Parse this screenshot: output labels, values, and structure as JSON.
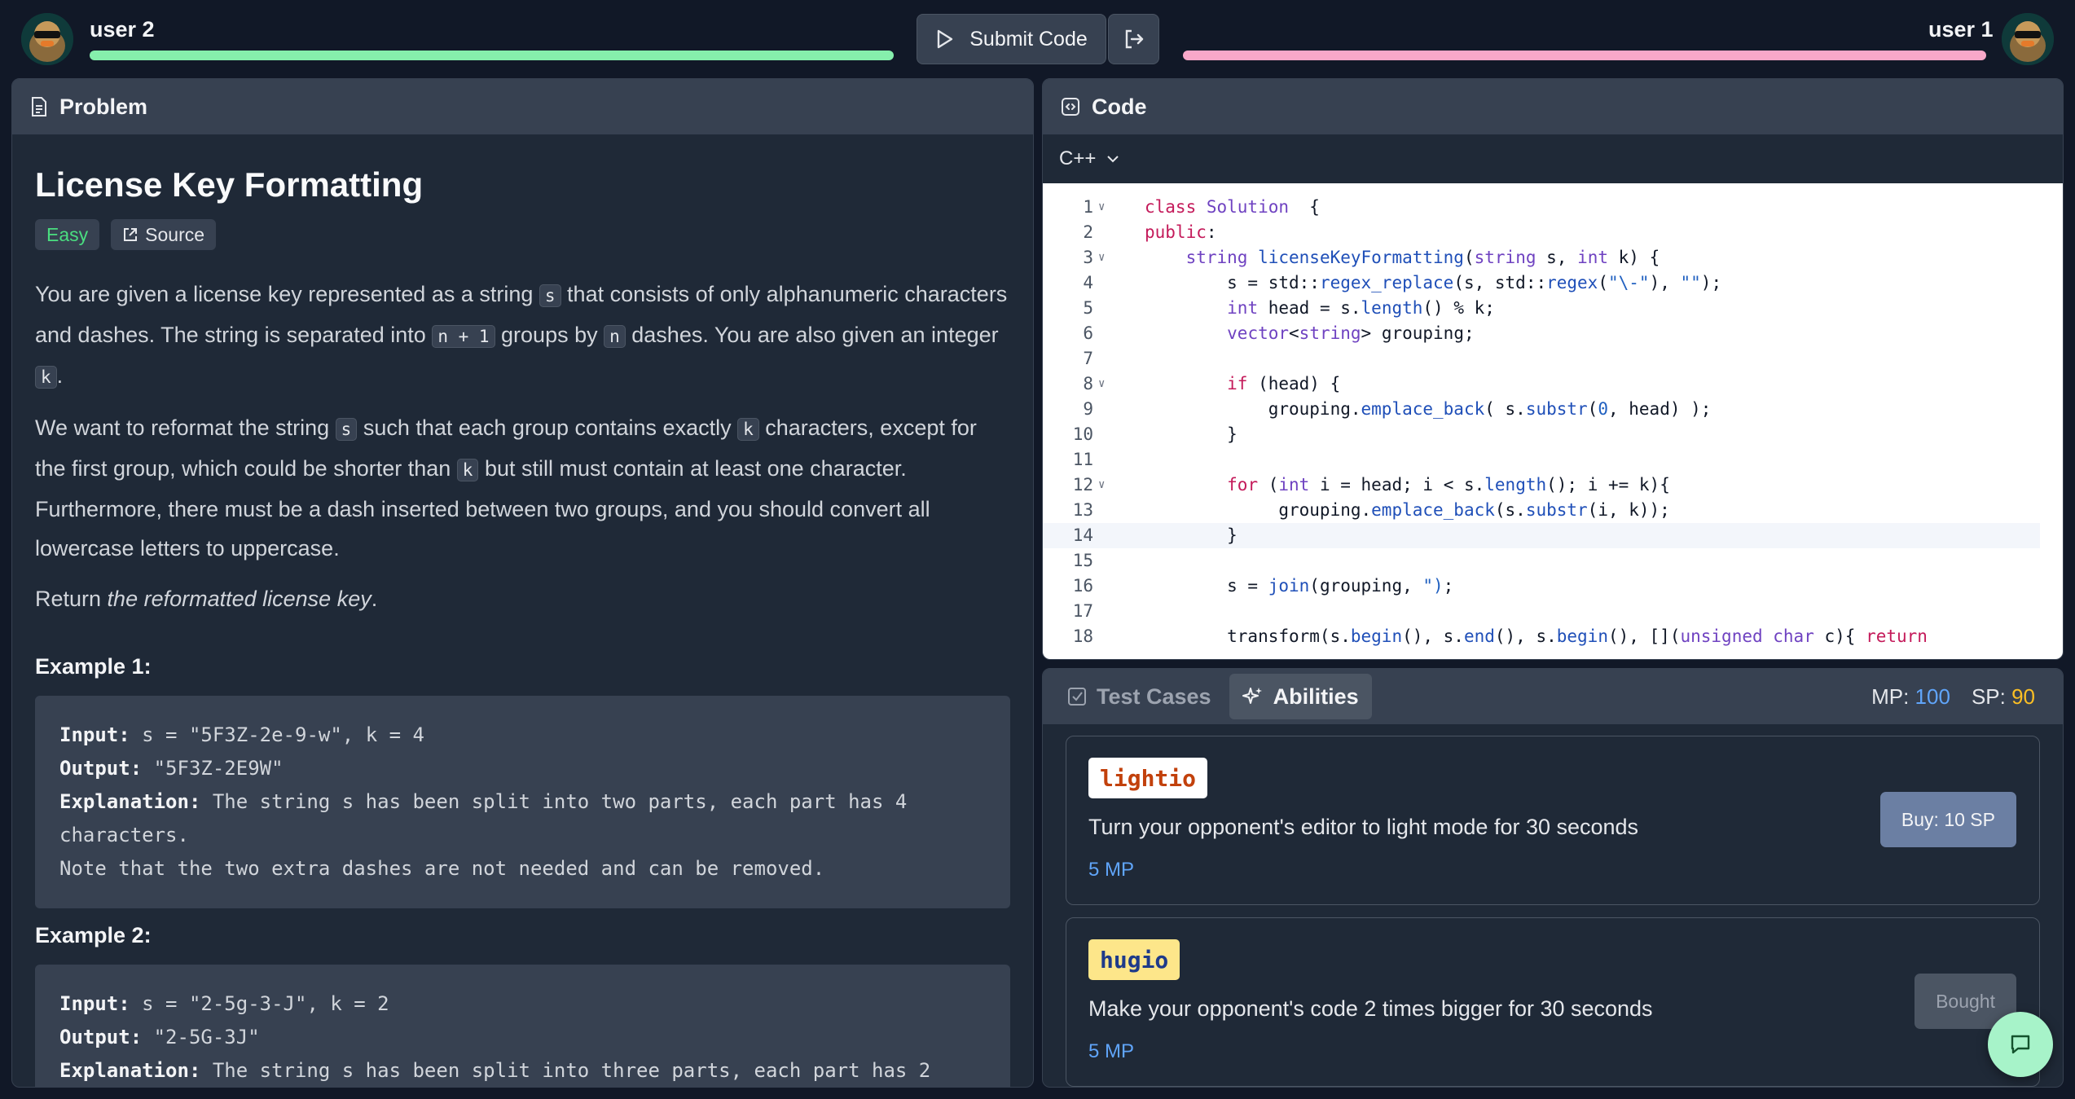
{
  "header": {
    "left_user": "user 2",
    "right_user": "user 1",
    "submit_label": "Submit Code",
    "left_bar_color": "#86efac",
    "right_bar_color": "#f9a8c9"
  },
  "problem": {
    "panel_title": "Problem",
    "title": "License Key Formatting",
    "difficulty": "Easy",
    "source_label": "Source",
    "p1": [
      "You are given a license key represented as a string ",
      "s",
      " that consists of only alphanumeric characters and dashes. The string is separated into ",
      "n + 1",
      " groups by ",
      "n",
      " dashes. You are also given an integer ",
      "k",
      "."
    ],
    "p2": [
      "We want to reformat the string ",
      "s",
      " such that each group contains exactly ",
      "k",
      " characters, except for the first group, which could be shorter than ",
      "k",
      " but still must contain at least one character. Furthermore, there must be a dash inserted between two groups, and you should convert all lowercase letters to uppercase."
    ],
    "p3_prefix": "Return ",
    "p3_em": "the reformatted license key",
    "p3_suffix": ".",
    "examples": [
      {
        "title": "Example 1:",
        "input_label": "Input:",
        "input": " s = \"5F3Z-2e-9-w\", k = 4",
        "output_label": "Output:",
        "output": " \"5F3Z-2E9W\"",
        "explanation_label": "Explanation:",
        "explanation": " The string s has been split into two parts, each part has 4",
        "explanation2": "characters.",
        "explanation3": "Note that the two extra dashes are not needed and can be removed."
      },
      {
        "title": "Example 2:",
        "input_label": "Input:",
        "input": " s = \"2-5g-3-J\", k = 2",
        "output_label": "Output:",
        "output": " \"2-5G-3J\"",
        "explanation_label": "Explanation:",
        "explanation": " The string s has been split into three parts, each part has 2"
      }
    ]
  },
  "code": {
    "panel_title": "Code",
    "language": "C++",
    "lines": [
      {
        "n": "1",
        "fold": true,
        "segs": [
          [
            "kw",
            "class "
          ],
          [
            "ty",
            "Solution"
          ],
          [
            "",
            "  {"
          ]
        ]
      },
      {
        "n": "2",
        "fold": false,
        "segs": [
          [
            "kw",
            "public"
          ],
          [
            "",
            ":"
          ]
        ]
      },
      {
        "n": "3",
        "fold": true,
        "segs": [
          [
            "",
            "    "
          ],
          [
            "ty",
            "string "
          ],
          [
            "fn",
            "licenseKeyFormatting"
          ],
          [
            "",
            "("
          ],
          [
            "ty",
            "string"
          ],
          [
            "",
            " s, "
          ],
          [
            "ty",
            "int"
          ],
          [
            "",
            " k) {"
          ]
        ]
      },
      {
        "n": "4",
        "fold": false,
        "segs": [
          [
            "",
            "        s = std::"
          ],
          [
            "fn",
            "regex_replace"
          ],
          [
            "",
            "(s, std::"
          ],
          [
            "fn",
            "regex"
          ],
          [
            "",
            "("
          ],
          [
            "st",
            "\"\\-\""
          ],
          [
            "",
            "), "
          ],
          [
            "st",
            "\"\""
          ],
          [
            "",
            ");"
          ]
        ]
      },
      {
        "n": "5",
        "fold": false,
        "segs": [
          [
            "",
            "        "
          ],
          [
            "ty",
            "int"
          ],
          [
            "",
            " head = s."
          ],
          [
            "fn",
            "length"
          ],
          [
            "",
            "() % k;"
          ]
        ]
      },
      {
        "n": "6",
        "fold": false,
        "segs": [
          [
            "",
            "        "
          ],
          [
            "ty",
            "vector"
          ],
          [
            "",
            "<"
          ],
          [
            "ty",
            "string"
          ],
          [
            "",
            "> grouping;"
          ]
        ]
      },
      {
        "n": "7",
        "fold": false,
        "segs": [
          [
            "",
            ""
          ]
        ]
      },
      {
        "n": "8",
        "fold": true,
        "segs": [
          [
            "",
            "        "
          ],
          [
            "kw",
            "if"
          ],
          [
            "",
            " (head) {"
          ]
        ]
      },
      {
        "n": "9",
        "fold": false,
        "segs": [
          [
            "",
            "            grouping."
          ],
          [
            "fn",
            "emplace_back"
          ],
          [
            "",
            "( s."
          ],
          [
            "fn",
            "substr"
          ],
          [
            "",
            "("
          ],
          [
            "st",
            "0"
          ],
          [
            "",
            ", head) );"
          ]
        ]
      },
      {
        "n": "10",
        "fold": false,
        "segs": [
          [
            "",
            "        }"
          ]
        ]
      },
      {
        "n": "11",
        "fold": false,
        "segs": [
          [
            "",
            ""
          ]
        ]
      },
      {
        "n": "12",
        "fold": true,
        "segs": [
          [
            "",
            "        "
          ],
          [
            "kw",
            "for"
          ],
          [
            "",
            " ("
          ],
          [
            "ty",
            "int"
          ],
          [
            "",
            " i = head; i < s."
          ],
          [
            "fn",
            "length"
          ],
          [
            "",
            "(); i += k){"
          ]
        ]
      },
      {
        "n": "13",
        "fold": false,
        "segs": [
          [
            "",
            "             grouping."
          ],
          [
            "fn",
            "emplace_back"
          ],
          [
            "",
            "(s."
          ],
          [
            "fn",
            "substr"
          ],
          [
            "",
            "(i, k));"
          ]
        ]
      },
      {
        "n": "14",
        "fold": false,
        "segs": [
          [
            "",
            "        }"
          ]
        ]
      },
      {
        "n": "15",
        "fold": false,
        "segs": [
          [
            "",
            ""
          ]
        ]
      },
      {
        "n": "16",
        "fold": false,
        "segs": [
          [
            "",
            "        s = "
          ],
          [
            "fn",
            "join"
          ],
          [
            "",
            "(grouping, "
          ],
          [
            "st",
            "\")"
          ],
          [
            "",
            ";"
          ]
        ]
      },
      {
        "n": "17",
        "fold": false,
        "segs": [
          [
            "",
            ""
          ]
        ]
      },
      {
        "n": "18",
        "fold": false,
        "segs": [
          [
            "",
            "        transform(s."
          ],
          [
            "fn",
            "begin"
          ],
          [
            "",
            "(), s."
          ],
          [
            "fn",
            "end"
          ],
          [
            "",
            "(), s."
          ],
          [
            "fn",
            "begin"
          ],
          [
            "",
            "(), []("
          ],
          [
            "ty",
            "unsigned char"
          ],
          [
            "",
            " c){ "
          ],
          [
            "kw",
            "return"
          ]
        ]
      }
    ]
  },
  "abilities": {
    "tab_tests": "Test Cases",
    "tab_abilities": "Abilities",
    "mp_label": "MP: ",
    "mp_value": "100",
    "sp_label": "SP: ",
    "sp_value": "90",
    "items": [
      {
        "name": "lightio",
        "desc": "Turn your opponent's editor to light mode for 30 seconds",
        "cost": "5 MP",
        "button": "Buy: 10 SP",
        "name_color": "#c2410c",
        "name_bg": "#ffffff",
        "button_style": "buy"
      },
      {
        "name": "hugio",
        "desc": "Make your opponent's code 2 times bigger for 30 seconds",
        "cost": "5 MP",
        "button": "Bought",
        "name_color": "#1e3a8a",
        "name_bg": "#fde68a",
        "button_style": "bought"
      }
    ]
  }
}
